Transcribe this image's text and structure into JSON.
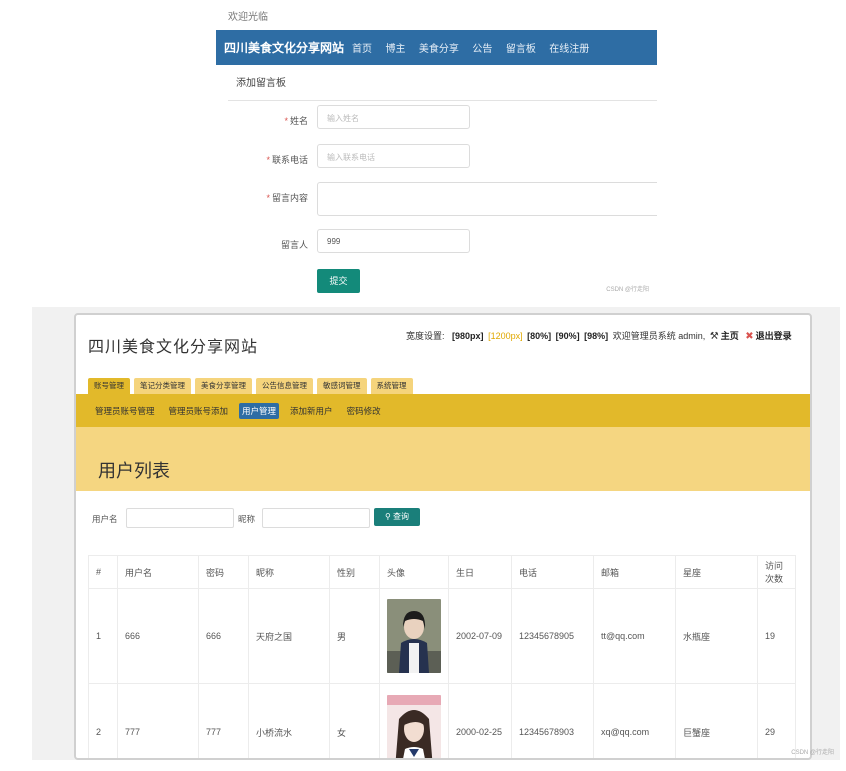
{
  "top": {
    "welcome": "欢迎光临",
    "brand": "四川美食文化分享网站",
    "nav": [
      "首页",
      "博主",
      "美食分享",
      "公告",
      "留言板",
      "在线注册"
    ],
    "card_title": "添加留言板",
    "form": {
      "name_label": "姓名",
      "name_placeholder": "输入姓名",
      "phone_label": "联系电话",
      "phone_placeholder": "输入联系电话",
      "content_label": "留言内容",
      "author_label": "留言人",
      "author_value": "999",
      "submit_label": "提交"
    },
    "watermark": "CSDN @行走阳"
  },
  "bottom": {
    "site_title": "四川美食文化分享网站",
    "width_label": "宽度设置:",
    "width_options": [
      "[980px]",
      "[1200px]",
      "[80%]",
      "[90%]",
      "[98%]"
    ],
    "width_active": "[1200px]",
    "welcome_text": "欢迎管理员系统 admin,",
    "home_link": "主页",
    "logout_link": "退出登录",
    "tabs": [
      "账号管理",
      "笔记分类管理",
      "美食分享管理",
      "公告信息管理",
      "敏感词管理",
      "系统管理"
    ],
    "subnav": [
      "管理员账号管理",
      "管理员账号添加",
      "用户管理",
      "添加新用户",
      "密码修改"
    ],
    "subnav_active": "用户管理",
    "page_heading": "用户列表",
    "filter": {
      "username_label": "用户名",
      "nickname_label": "昵称",
      "search_label": "查询"
    },
    "table": {
      "headers": [
        "#",
        "用户名",
        "密码",
        "昵称",
        "性别",
        "头像",
        "生日",
        "电话",
        "邮箱",
        "星座",
        "访问次数"
      ],
      "rows": [
        {
          "no": "1",
          "username": "666",
          "password": "666",
          "nickname": "天府之国",
          "gender": "男",
          "birthday": "2002-07-09",
          "phone": "12345678905",
          "email": "tt@qq.com",
          "zodiac": "水瓶座",
          "visits": "19"
        },
        {
          "no": "2",
          "username": "777",
          "password": "777",
          "nickname": "小桥流水",
          "gender": "女",
          "birthday": "2000-02-25",
          "phone": "12345678903",
          "email": "xq@qq.com",
          "zodiac": "巨蟹座",
          "visits": "29"
        }
      ]
    },
    "watermark": "CSDN @行走阳"
  },
  "colors": {
    "top_navbar": "#2e6da4",
    "submit": "#138a7a",
    "tab": "#f5d47c",
    "subnav": "#e2b92a",
    "banner": "#f5d681",
    "search_button": "#1a7f7a"
  }
}
